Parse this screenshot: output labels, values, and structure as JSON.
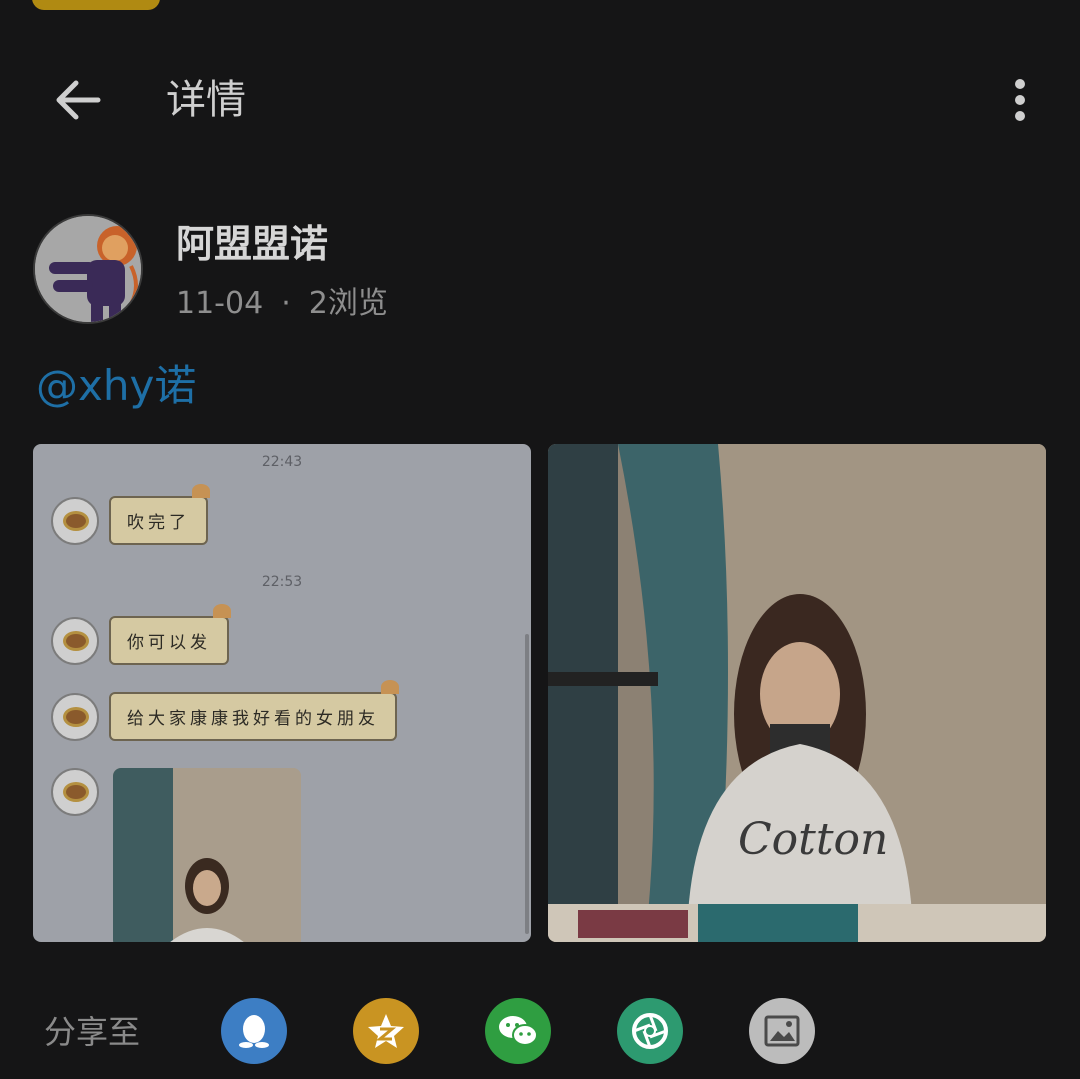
{
  "header": {
    "title": "详情",
    "back_icon": "arrow-left-icon",
    "more_icon": "more-vertical-icon"
  },
  "post": {
    "author": "阿盟盟诺",
    "date": "11-04",
    "separator": "·",
    "views": "2浏览",
    "mention": "@xhy诺"
  },
  "chat": {
    "time1": "22:43",
    "msg1": "吹完了",
    "time2": "22:53",
    "msg2": "你可以发",
    "msg3": "给大家康康我好看的女朋友"
  },
  "share": {
    "label": "分享至",
    "targets": [
      {
        "name": "qq",
        "icon": "qq-penguin-icon",
        "color": "#3d7ec4"
      },
      {
        "name": "qzone",
        "icon": "qzone-star-icon",
        "color": "#c99422"
      },
      {
        "name": "wechat",
        "icon": "wechat-icon",
        "color": "#2f9e41"
      },
      {
        "name": "moments",
        "icon": "moments-aperture-icon",
        "color": "#2d9a70"
      },
      {
        "name": "save-image",
        "icon": "picture-icon",
        "color": "#bcbcbc"
      }
    ]
  },
  "colors": {
    "background": "#151516",
    "mention": "#1e6fa6",
    "top_pill": "#b08a12"
  }
}
